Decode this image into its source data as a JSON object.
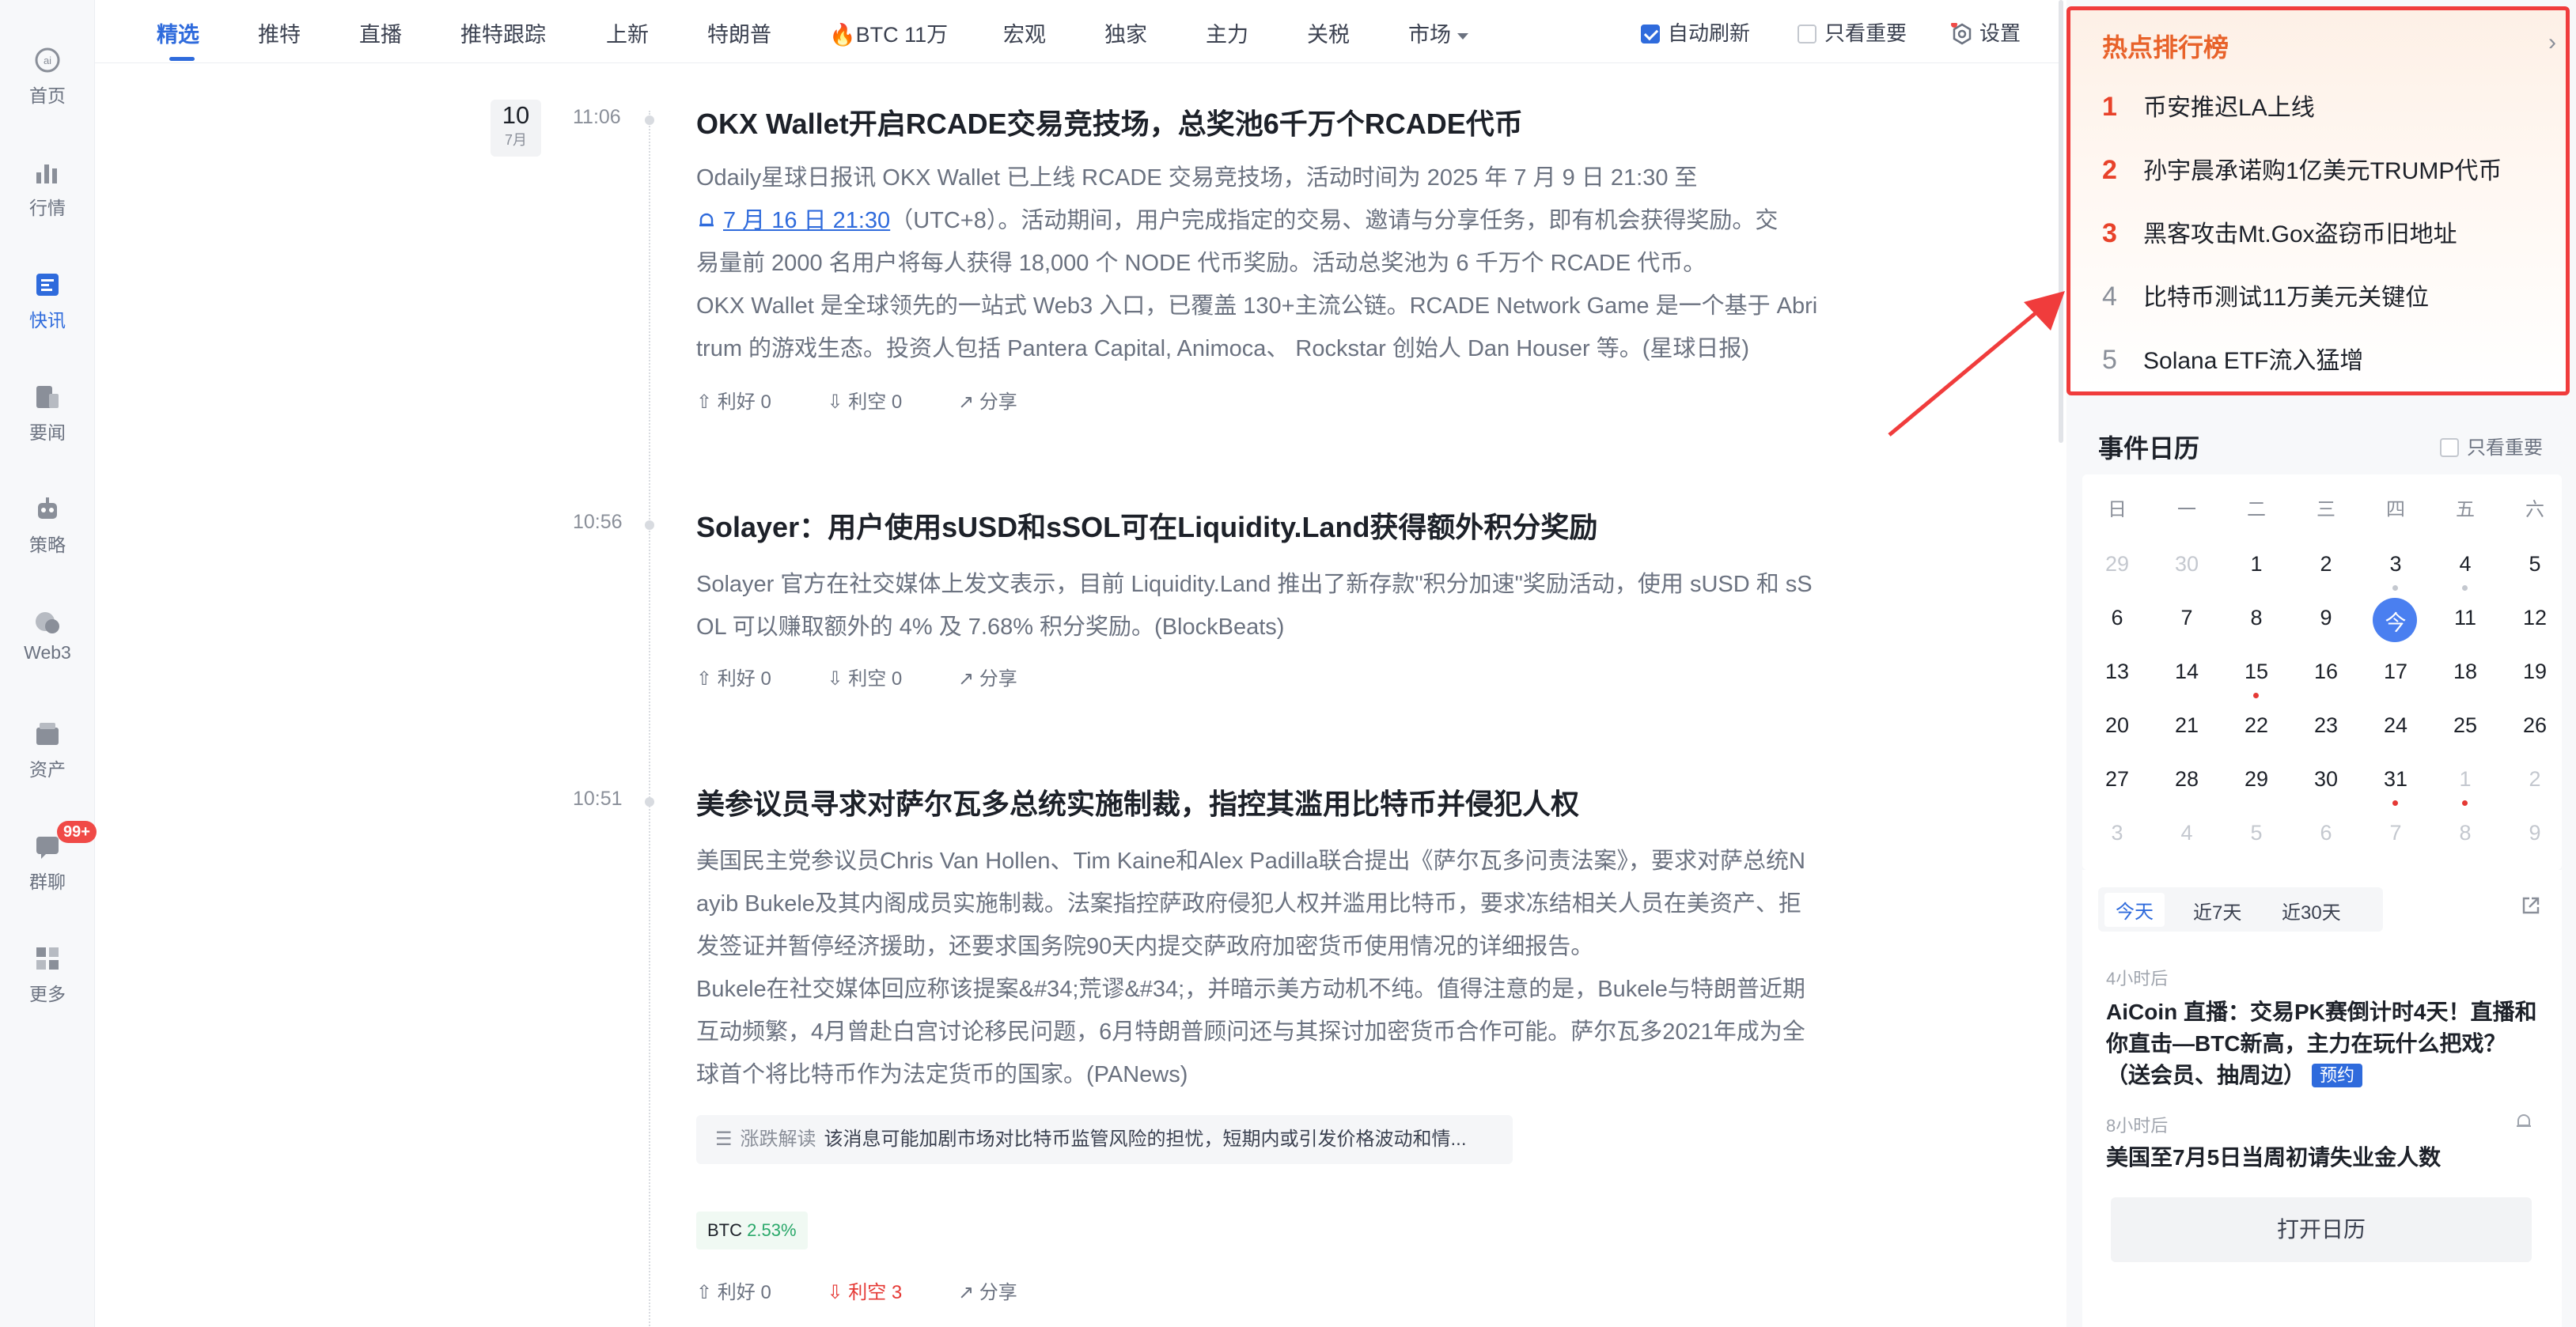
{
  "nav": {
    "items": [
      {
        "label": "首页",
        "icon": "home-icon"
      },
      {
        "label": "行情",
        "icon": "market-chart-icon"
      },
      {
        "label": "快讯",
        "icon": "flash-news-icon"
      },
      {
        "label": "要闻",
        "icon": "headline-news-icon"
      },
      {
        "label": "策略",
        "icon": "robot-strategy-icon"
      },
      {
        "label": "Web3",
        "icon": "web3-icon"
      },
      {
        "label": "资产",
        "icon": "wallet-icon"
      },
      {
        "label": "群聊",
        "icon": "chat-icon"
      },
      {
        "label": "更多",
        "icon": "more-grid-icon"
      }
    ],
    "chat_badge": "99+",
    "active": "快讯"
  },
  "tabs": {
    "items": [
      "精选",
      "推特",
      "直播",
      "推特跟踪",
      "上新",
      "特朗普",
      "🔥BTC 11万",
      "宏观",
      "独家",
      "主力",
      "关税",
      "市场"
    ],
    "active": "精选",
    "auto_refresh": "自动刷新",
    "only_important": "只看重要",
    "settings": "设置"
  },
  "feed": {
    "date_day": "10",
    "date_month": "7月",
    "items": [
      {
        "time": "11:06",
        "title": "OKX Wallet开启RCADE交易竞技场，总奖池6千万个RCADE代币",
        "body_l1": "Odaily星球日报讯 OKX Wallet 已上线 RCADE 交易竞技场，活动时间为 2025 年 7 月 9 日 21:30 至",
        "body_link": "7 月 16 日 21:30",
        "body_l2_rest": "（UTC+8）。活动期间，用户完成指定的交易、邀请与分享任务，即有机会获得奖励。交",
        "body_l3": "易量前 2000 名用户将每人获得 18,000 个 NODE 代币奖励。活动总奖池为 6 千万个 RCADE 代币。",
        "body_l4": "OKX Wallet 是全球领先的一站式 Web3 入口，已覆盖 130+主流公链。RCADE Network Game 是一个基于 Abri",
        "body_l5": "trum 的游戏生态。投资人包括 Pantera Capital, Animoca、 Rockstar 创始人 Dan Houser 等。(星球日报)",
        "bullish": "利好 0",
        "bearish": "利空 0",
        "share": "分享"
      },
      {
        "time": "10:56",
        "title": "Solayer：用户使用sUSD和sSOL可在Liquidity.Land获得额外积分奖励",
        "body_l1": "Solayer 官方在社交媒体上发文表示，目前 Liquidity.Land 推出了新存款\"积分加速\"奖励活动，使用 sUSD 和 sS",
        "body_l2": "OL 可以赚取额外的 4% 及 7.68% 积分奖励。(BlockBeats)",
        "bullish": "利好 0",
        "bearish": "利空 0",
        "share": "分享"
      },
      {
        "time": "10:51",
        "title": "美参议员寻求对萨尔瓦多总统实施制裁，指控其滥用比特币并侵犯人权",
        "body_l1": "美国民主党参议员Chris Van Hollen、Tim Kaine和Alex Padilla联合提出《萨尔瓦多问责法案》，要求对萨总统N",
        "body_l2": "ayib Bukele及其内阁成员实施制裁。法案指控萨政府侵犯人权并滥用比特币，要求冻结相关人员在美资产、拒",
        "body_l3": "发签证并暂停经济援助，还要求国务院90天内提交萨政府加密货币使用情况的详细报告。",
        "body_l4": "Bukele在社交媒体回应称该提案&#34;荒谬&#34;，并暗示美方动机不纯。值得注意的是，Bukele与特朗普近期",
        "body_l5": "互动频繁，4月曾赴白宫讨论移民问题，6月特朗普顾问还与其探讨加密货币合作可能。萨尔瓦多2021年成为全",
        "body_l6": "球首个将比特币作为法定货币的国家。(PANews)",
        "analysis_label": "涨跌解读",
        "analysis_text": "该消息可能加剧市场对比特币监管风险的担忧，短期内或引发价格波动和情...",
        "coin": "BTC",
        "coin_change": "2.53%",
        "bullish": "利好 0",
        "bearish": "利空 3",
        "share": "分享"
      }
    ]
  },
  "hot": {
    "title": "热点排行榜",
    "items": [
      {
        "rank": "1",
        "text": "币安推迟LA上线"
      },
      {
        "rank": "2",
        "text": "孙宇晨承诺购1亿美元TRUMP代币"
      },
      {
        "rank": "3",
        "text": "黑客攻击Mt.Gox盗窃币旧地址"
      },
      {
        "rank": "4",
        "text": "比特币测试11万美元关键位"
      },
      {
        "rank": "5",
        "text": "Solana ETF流入猛增"
      }
    ]
  },
  "calendar": {
    "title": "事件日历",
    "only_important": "只看重要",
    "weekdays": [
      "日",
      "一",
      "二",
      "三",
      "四",
      "五",
      "六"
    ],
    "weeks": [
      [
        "29",
        "30",
        "1",
        "2",
        "3",
        "4",
        "5"
      ],
      [
        "6",
        "7",
        "8",
        "9",
        "今",
        "11",
        "12"
      ],
      [
        "13",
        "14",
        "15",
        "16",
        "17",
        "18",
        "19"
      ],
      [
        "20",
        "21",
        "22",
        "23",
        "24",
        "25",
        "26"
      ],
      [
        "27",
        "28",
        "29",
        "30",
        "31",
        "1",
        "2"
      ],
      [
        "3",
        "4",
        "5",
        "6",
        "7",
        "8",
        "9"
      ]
    ],
    "tabs": [
      "今天",
      "近7天",
      "近30天"
    ],
    "active_tab": "今天",
    "events": [
      {
        "time": "4小时后",
        "title": "AiCoin 直播：交易PK赛倒计时4天！直播和你直击—BTC新高，主力在玩什么把戏？（送会员、抽周边）",
        "badge": "预约"
      },
      {
        "time": "8小时后",
        "title": "美国至7月5日当周初请失业金人数"
      }
    ],
    "open_button": "打开日历"
  },
  "colors": {
    "accent": "#2f6bdc",
    "hot_border": "#f03c3c",
    "bearish": "#e53935",
    "bullish_coin": "#2aa86a"
  }
}
